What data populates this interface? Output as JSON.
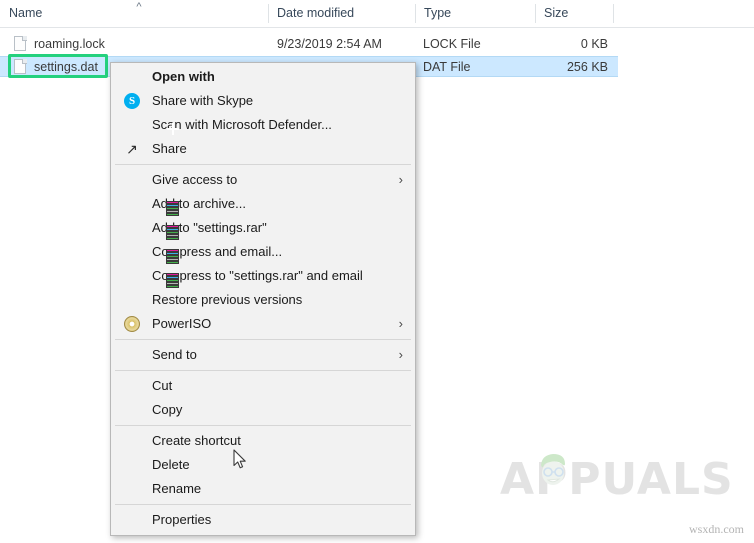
{
  "explorer": {
    "columns": [
      {
        "label": "Name",
        "key": "name"
      },
      {
        "label": "Date modified",
        "key": "date"
      },
      {
        "label": "Type",
        "key": "type"
      },
      {
        "label": "Size",
        "key": "size"
      }
    ],
    "sort": {
      "column": "Name",
      "direction": "ascending",
      "icon": "chevron-up-icon"
    },
    "rows": [
      {
        "name": "roaming.lock",
        "date": "9/23/2019 2:54 AM",
        "type": "LOCK File",
        "size": "0 KB",
        "selected": false,
        "icon": "generic-file-icon"
      },
      {
        "name": "settings.dat",
        "date": "",
        "type": "DAT File",
        "size": "256 KB",
        "selected": true,
        "icon": "generic-file-icon"
      }
    ]
  },
  "context_menu": {
    "groups": [
      {
        "items": [
          {
            "label": "Open with",
            "icon": null,
            "bold": true,
            "submenu": false
          },
          {
            "label": "Share with Skype",
            "icon": "skype-icon",
            "bold": false,
            "submenu": false
          },
          {
            "label": "Scan with Microsoft Defender...",
            "icon": "defender-shield-icon",
            "bold": false,
            "submenu": false
          },
          {
            "label": "Share",
            "icon": "share-icon",
            "bold": false,
            "submenu": false
          }
        ]
      },
      {
        "items": [
          {
            "label": "Give access to",
            "icon": null,
            "bold": false,
            "submenu": true
          },
          {
            "label": "Add to archive...",
            "icon": "winrar-icon",
            "bold": false,
            "submenu": false
          },
          {
            "label": "Add to \"settings.rar\"",
            "icon": "winrar-icon",
            "bold": false,
            "submenu": false
          },
          {
            "label": "Compress and email...",
            "icon": "winrar-icon",
            "bold": false,
            "submenu": false
          },
          {
            "label": "Compress to \"settings.rar\" and email",
            "icon": "winrar-icon",
            "bold": false,
            "submenu": false
          },
          {
            "label": "Restore previous versions",
            "icon": null,
            "bold": false,
            "submenu": false
          },
          {
            "label": "PowerISO",
            "icon": "poweriso-icon",
            "bold": false,
            "submenu": true
          }
        ]
      },
      {
        "items": [
          {
            "label": "Send to",
            "icon": null,
            "bold": false,
            "submenu": true
          }
        ]
      },
      {
        "items": [
          {
            "label": "Cut",
            "icon": null,
            "bold": false,
            "submenu": false
          },
          {
            "label": "Copy",
            "icon": null,
            "bold": false,
            "submenu": false
          }
        ]
      },
      {
        "items": [
          {
            "label": "Create shortcut",
            "icon": null,
            "bold": false,
            "submenu": false
          },
          {
            "label": "Delete",
            "icon": null,
            "bold": false,
            "submenu": false
          },
          {
            "label": "Rename",
            "icon": null,
            "bold": false,
            "submenu": false,
            "highlighted": true
          }
        ]
      },
      {
        "items": [
          {
            "label": "Properties",
            "icon": null,
            "bold": false,
            "submenu": false
          }
        ]
      }
    ],
    "submenu_arrow_glyph": "›"
  },
  "annotations": {
    "highlight_color": "#24d17e",
    "boxes": [
      {
        "target": "settings.dat file item"
      },
      {
        "target": "Rename menu item"
      }
    ]
  },
  "watermark": {
    "brand": "APPUALS",
    "site": "wsxdn.com"
  }
}
